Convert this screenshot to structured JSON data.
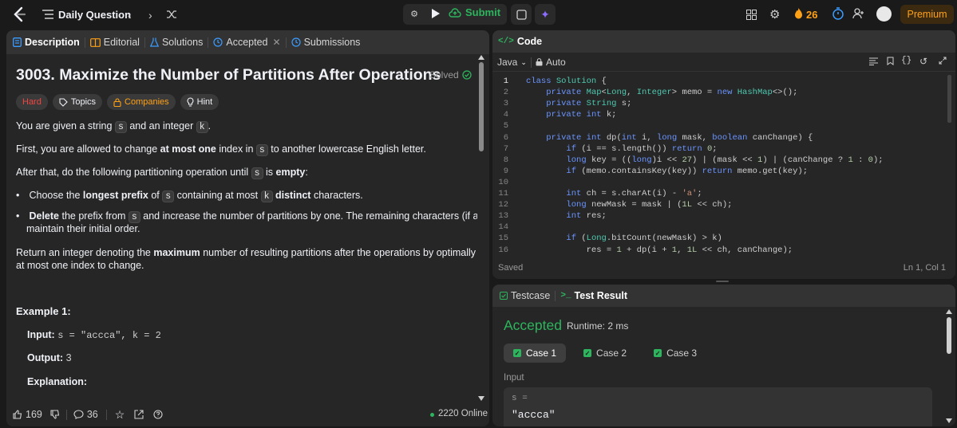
{
  "topbar": {
    "title": "Daily Question",
    "submit_label": "Submit",
    "streak": "26",
    "premium_label": "Premium"
  },
  "left_tabs": [
    {
      "label": "Description",
      "icon": "description-icon"
    },
    {
      "label": "Editorial",
      "icon": "book-icon"
    },
    {
      "label": "Solutions",
      "icon": "flask-icon"
    },
    {
      "label": "Accepted",
      "icon": "history-icon"
    },
    {
      "label": "Submissions",
      "icon": "history-icon"
    }
  ],
  "problem": {
    "title": "3003. Maximize the Number of Partitions After Operations",
    "solved_label": "Solved",
    "difficulty": "Hard",
    "tags": [
      "Topics",
      "Companies",
      "Hint"
    ],
    "p1_a": "You are given a string",
    "p1_b": "and an integer",
    "p2_a": "First, you are allowed to change",
    "p2_b": "at most one",
    "p2_c": "index in",
    "p2_d": "to another lowercase English letter.",
    "p3_a": "After that, do the following partitioning operation until",
    "p3_b": "is",
    "p3_c": "empty",
    "b1_a": "Choose the",
    "b1_b": "longest prefix",
    "b1_c": "of",
    "b1_d": "containing at most",
    "b1_e": "distinct",
    "b1_f": "characters.",
    "b2_a": "Delete",
    "b2_b": "the prefix from",
    "b2_c": "and increase the number of partitions by one. The remaining characters (if any) in",
    "b2_d": "maintain their initial order.",
    "p4_a": "Return an integer denoting the",
    "p4_b": "maximum",
    "p4_c": "number of resulting partitions after the operations by optimally choosing",
    "p4_d": "at most one index to change.",
    "var_s": "s",
    "var_k": "k",
    "colon": ":",
    "example_title": "Example 1:",
    "input_label": "Input:",
    "input_value": "s = \"accca\", k = 2",
    "output_label": "Output:",
    "output_value": "3",
    "explanation_label": "Explanation:"
  },
  "left_footer": {
    "likes": "169",
    "comments": "36",
    "online": "2220 Online"
  },
  "code_panel": {
    "title": "Code",
    "language": "Java",
    "mode": "Auto",
    "saved": "Saved",
    "cursor": "Ln 1, Col 1",
    "lines": [
      "class Solution {",
      "    private Map<Long, Integer> memo = new HashMap<>();",
      "    private String s;",
      "    private int k;",
      "",
      "    private int dp(int i, long mask, boolean canChange) {",
      "        if (i == s.length()) return 0;",
      "        long key = ((long)i << 27) | (mask << 1) | (canChange ? 1 : 0);",
      "        if (memo.containsKey(key)) return memo.get(key);",
      "",
      "        int ch = s.charAt(i) - 'a';",
      "        long newMask = mask | (1L << ch);",
      "        int res;",
      "",
      "        if (Long.bitCount(newMask) > k)",
      "            res = 1 + dp(i + 1, 1L << ch, canChange);"
    ]
  },
  "result_panel": {
    "testcase_tab": "Testcase",
    "result_tab": "Test Result",
    "status": "Accepted",
    "runtime": "Runtime: 2 ms",
    "cases": [
      "Case 1",
      "Case 2",
      "Case 3"
    ],
    "input_label": "Input",
    "var_label": "s =",
    "var_value": "\"accca\""
  },
  "colors": {
    "accent_green": "#2db55d",
    "hard_red": "#ef4743",
    "premium_orange": "#ffa116"
  }
}
